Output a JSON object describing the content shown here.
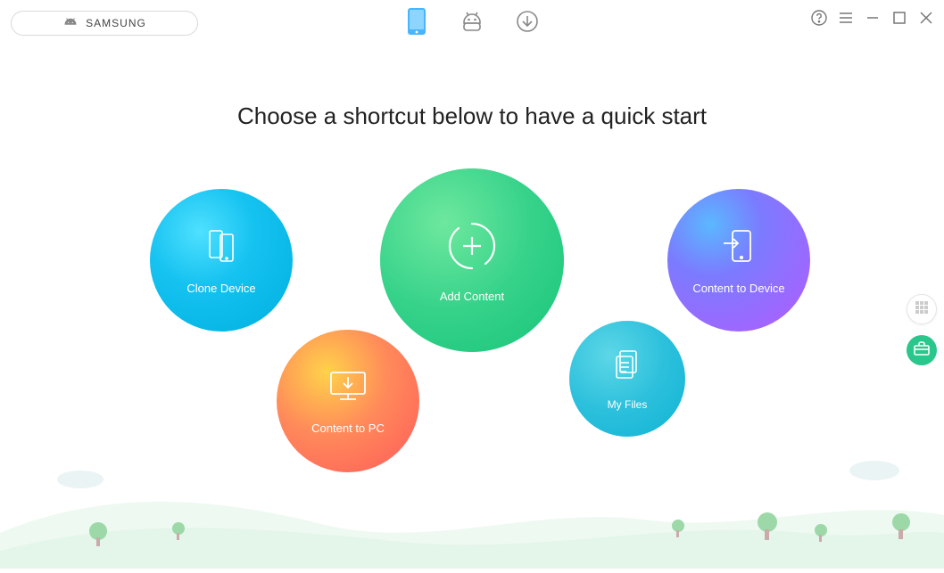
{
  "toolbar": {
    "device_label": "SAMSUNG",
    "nav": {
      "phone_icon": "phone-icon",
      "android_icon": "android-icon",
      "download_icon": "download-icon"
    },
    "controls": {
      "help": "help-icon",
      "menu": "menu-icon",
      "minimize": "minimize-icon",
      "maximize": "maximize-icon",
      "close": "close-icon"
    }
  },
  "title": "Choose a shortcut below to have a quick start",
  "shortcuts": {
    "clone": {
      "label": "Clone Device"
    },
    "add": {
      "label": "Add Content"
    },
    "content_to_device": {
      "label": "Content to Device"
    },
    "content_to_pc": {
      "label": "Content to PC"
    },
    "my_files": {
      "label": "My Files"
    }
  },
  "side_tabs": {
    "grid": "grid-view-icon",
    "toolbox": "toolbox-icon"
  }
}
